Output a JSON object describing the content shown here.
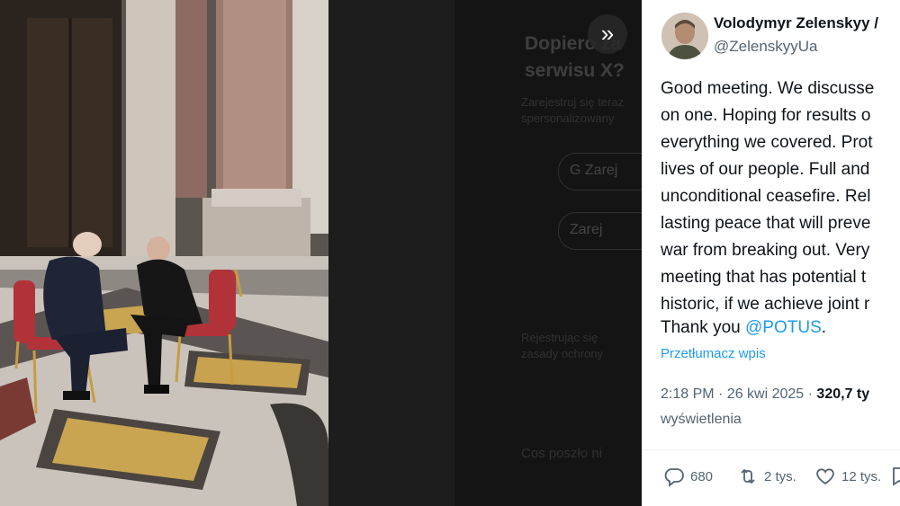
{
  "modal": {
    "next_label": "»"
  },
  "background": {
    "title_line1": "Dopiero za",
    "title_line2": "serwisu X?",
    "sub1": "Zarejestruj się teraz",
    "sub2": "spersonalizowany",
    "btn1": "G  Zarej",
    "btn2": "   Zarej",
    "footer1": "Rejestrując się",
    "footer2": "zasady ochrony",
    "footer3": "Cos poszło ni"
  },
  "tweet": {
    "author_name": "Volodymyr Zelenskyy / ",
    "author_handle": "@ZelenskyyUa",
    "lines": [
      "Good meeting. We discusse",
      "on one. Hoping for results o",
      "everything we covered. Prot",
      "lives of our people. Full and",
      "unconditional ceasefire. Rel",
      "lasting peace that will preve",
      "war from breaking out. Very",
      "meeting that has potential t",
      "historic, if we achieve joint r"
    ],
    "last_line_text": "Thank you ",
    "mention": "@POTUS",
    "last_line_end": ".",
    "translate": "Przetłumacz wpis",
    "time": "2:18 PM · 26 kwi 2025 · ",
    "views_count": "320,7 ty",
    "views_label": "wyświetlenia",
    "replies": "680",
    "reposts": "2 tys.",
    "likes": "12 tys."
  },
  "colors": {
    "link": "#1d9bf0",
    "text": "#0f1419",
    "muted": "#536471"
  }
}
